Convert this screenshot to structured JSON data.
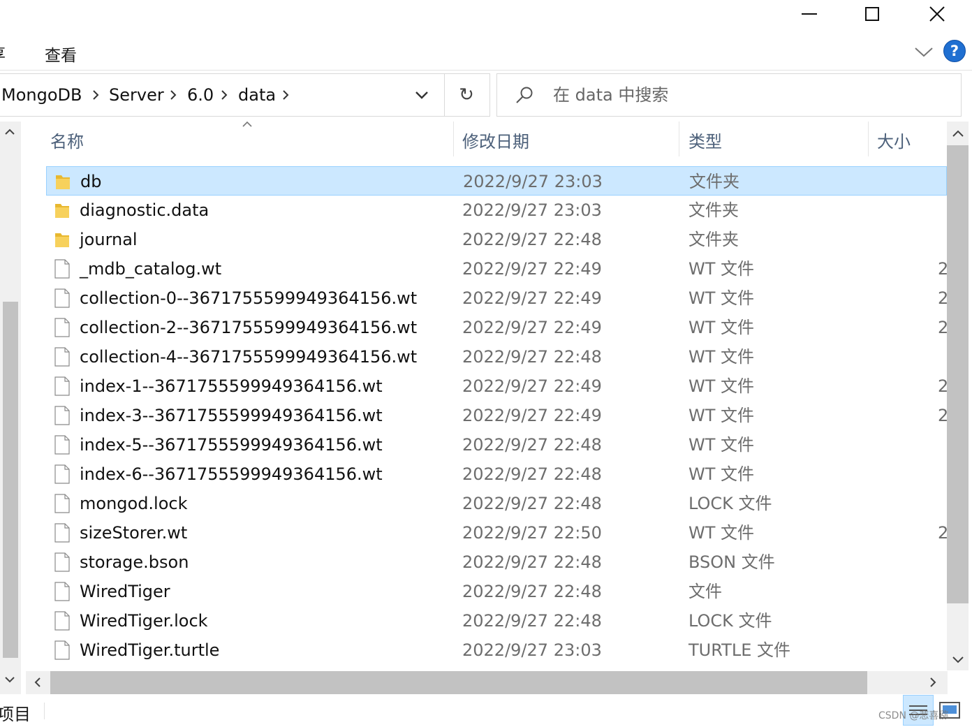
{
  "ribbon": {
    "cut_tab_fragment": "享",
    "view_tab": "查看",
    "help_label": "?"
  },
  "address": {
    "crumbs": [
      "MongoDB",
      "Server",
      "6.0",
      "data"
    ]
  },
  "toolbar": {
    "refresh_glyph": "↻"
  },
  "search": {
    "placeholder": "在 data 中搜索"
  },
  "columns": {
    "name": "名称",
    "date": "修改日期",
    "type": "类型",
    "size": "大小"
  },
  "files": [
    {
      "name": "db",
      "date": "2022/9/27 23:03",
      "type": "文件夹",
      "size": "",
      "icon": "folder-icon",
      "selected": true
    },
    {
      "name": "diagnostic.data",
      "date": "2022/9/27 23:03",
      "type": "文件夹",
      "size": "",
      "icon": "folder-icon"
    },
    {
      "name": "journal",
      "date": "2022/9/27 22:48",
      "type": "文件夹",
      "size": "",
      "icon": "folder-icon"
    },
    {
      "name": "_mdb_catalog.wt",
      "date": "2022/9/27 22:49",
      "type": "WT 文件",
      "size": "2",
      "icon": "file-icon"
    },
    {
      "name": "collection-0--3671755599949364156.wt",
      "date": "2022/9/27 22:49",
      "type": "WT 文件",
      "size": "2",
      "icon": "file-icon"
    },
    {
      "name": "collection-2--3671755599949364156.wt",
      "date": "2022/9/27 22:49",
      "type": "WT 文件",
      "size": "2",
      "icon": "file-icon"
    },
    {
      "name": "collection-4--3671755599949364156.wt",
      "date": "2022/9/27 22:48",
      "type": "WT 文件",
      "size": "",
      "icon": "file-icon"
    },
    {
      "name": "index-1--3671755599949364156.wt",
      "date": "2022/9/27 22:49",
      "type": "WT 文件",
      "size": "2",
      "icon": "file-icon"
    },
    {
      "name": "index-3--3671755599949364156.wt",
      "date": "2022/9/27 22:49",
      "type": "WT 文件",
      "size": "2",
      "icon": "file-icon"
    },
    {
      "name": "index-5--3671755599949364156.wt",
      "date": "2022/9/27 22:48",
      "type": "WT 文件",
      "size": "",
      "icon": "file-icon"
    },
    {
      "name": "index-6--3671755599949364156.wt",
      "date": "2022/9/27 22:48",
      "type": "WT 文件",
      "size": "",
      "icon": "file-icon"
    },
    {
      "name": "mongod.lock",
      "date": "2022/9/27 22:48",
      "type": "LOCK 文件",
      "size": "",
      "icon": "file-icon"
    },
    {
      "name": "sizeStorer.wt",
      "date": "2022/9/27 22:50",
      "type": "WT 文件",
      "size": "2",
      "icon": "file-icon"
    },
    {
      "name": "storage.bson",
      "date": "2022/9/27 22:48",
      "type": "BSON 文件",
      "size": "",
      "icon": "file-icon"
    },
    {
      "name": "WiredTiger",
      "date": "2022/9/27 22:48",
      "type": "文件",
      "size": "",
      "icon": "file-icon"
    },
    {
      "name": "WiredTiger.lock",
      "date": "2022/9/27 22:48",
      "type": "LOCK 文件",
      "size": "",
      "icon": "file-icon"
    },
    {
      "name": "WiredTiger.turtle",
      "date": "2022/9/27 23:03",
      "type": "TURTLE 文件",
      "size": "",
      "icon": "file-icon"
    }
  ],
  "status": {
    "items_fragment": "项目"
  },
  "watermark": "CSDN @悲喜猕",
  "colors": {
    "selection_bg": "#cce8ff",
    "selection_border": "#99d1ff",
    "help_blue": "#1f6fd1",
    "folder_yellow": "#f5c542",
    "header_text": "#4c607a"
  }
}
